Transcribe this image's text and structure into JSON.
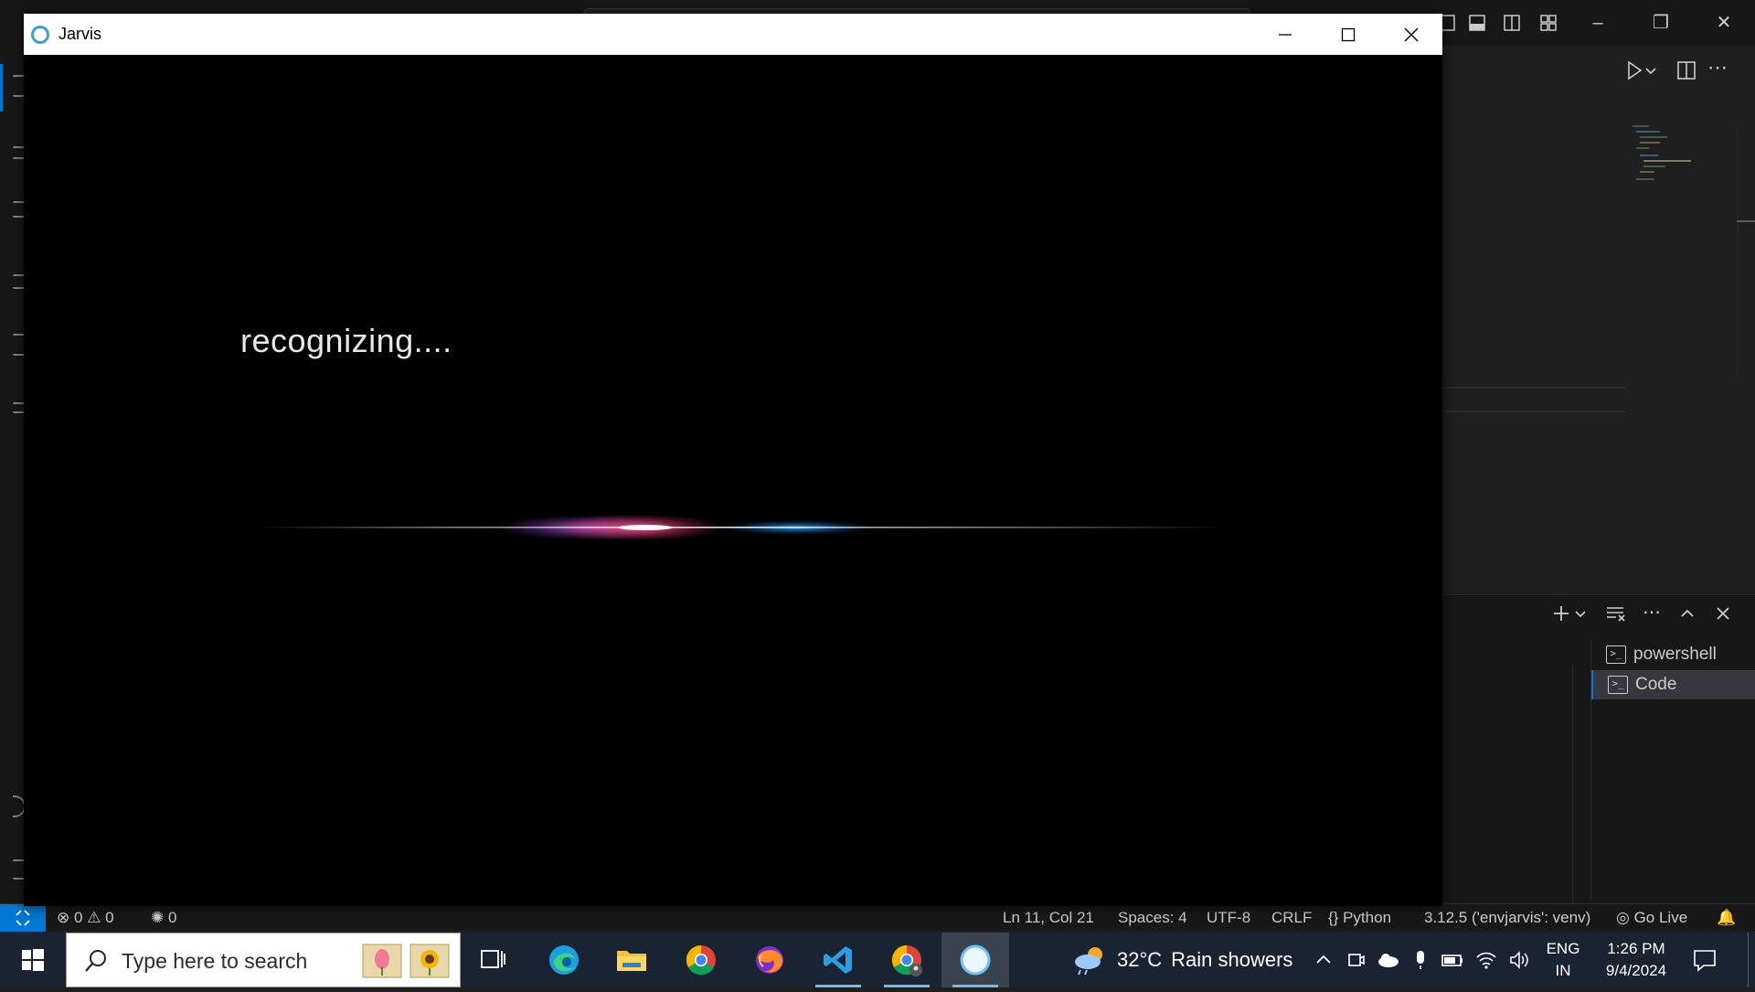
{
  "jarvis": {
    "title": "Jarvis",
    "status_text": "recognizing....",
    "controls": {
      "minimize": "minimize",
      "maximize": "maximize",
      "close": "close"
    }
  },
  "vscode": {
    "terminal_tabs": [
      {
        "label": "powershell",
        "icon": "terminal-icon",
        "active": false
      },
      {
        "label": "Code",
        "icon": "terminal-icon",
        "active": true
      }
    ],
    "statusbar": {
      "errors": "0",
      "warnings": "0",
      "ports": "0",
      "cursor": "Ln 11, Col 21",
      "indent": "Spaces: 4",
      "encoding": "UTF-8",
      "eol": "CRLF",
      "language": "Python",
      "interpreter": "3.12.5 ('envjarvis': venv)",
      "go_live": "Go Live"
    },
    "accent": "#0078d4"
  },
  "taskbar": {
    "search_placeholder": "Type here to search",
    "apps": [
      "task-view",
      "edge",
      "file-explorer",
      "chrome",
      "firefox",
      "vscode",
      "chrome-profile",
      "jarvis"
    ],
    "active_app": "jarvis",
    "weather": {
      "temp": "32°C",
      "condition": "Rain showers"
    },
    "language": {
      "line1": "ENG",
      "line2": "IN"
    },
    "clock": {
      "time": "1:26 PM",
      "date": "9/4/2024"
    }
  }
}
